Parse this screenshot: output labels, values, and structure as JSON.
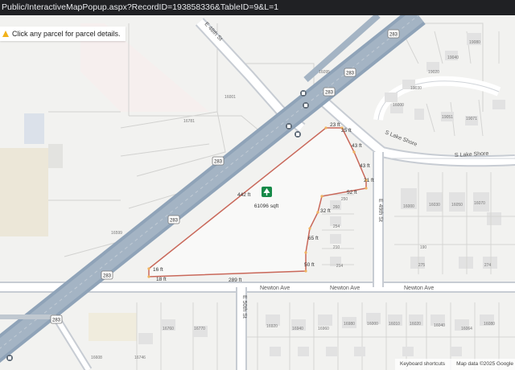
{
  "browser": {
    "url": "Public/InteractiveMapPopup.aspx?RecordID=193858336&TableID=9&L=1"
  },
  "notice": {
    "icon": "warning-icon",
    "text": "Click any parcel for parcel details."
  },
  "map": {
    "streets": {
      "e_48th": "E 48th St",
      "s_lake_shore": "S Lake Shore",
      "newton_1": "Newton Ave",
      "newton_2": "Newton Ave",
      "newton_3": "Newton Ave",
      "e_49th": "E 49th St",
      "e_50th": "E 50th St"
    },
    "route_shields": [
      "283",
      "283",
      "283",
      "283",
      "283",
      "283",
      "283"
    ],
    "selected_parcel": {
      "icon": "tree-icon",
      "area": "61096 sqft",
      "dimensions": [
        "23 ft",
        "25 ft",
        "43 ft",
        "43 ft",
        "21 ft",
        "52 ft",
        "32 ft",
        "65 ft",
        "50 ft",
        "289 ft",
        "18 ft",
        "16 ft",
        "442 ft"
      ]
    },
    "parcel_numbers": [
      "16095",
      "16001",
      "16781",
      "16599",
      "19020",
      "19040",
      "19080",
      "19030",
      "16000",
      "19051",
      "19071",
      "250",
      "260",
      "254",
      "210",
      "214",
      "16000",
      "16030",
      "16050",
      "16070",
      "190",
      "275",
      "274",
      "16920",
      "16940",
      "16960",
      "16980",
      "16000",
      "16010",
      "16020",
      "16040",
      "16064",
      "16080",
      "16760",
      "16770",
      "16746",
      "16608"
    ]
  },
  "footer": {
    "shortcuts": "Keyboard shortcuts",
    "attribution": "Map data ©2025 Google"
  }
}
